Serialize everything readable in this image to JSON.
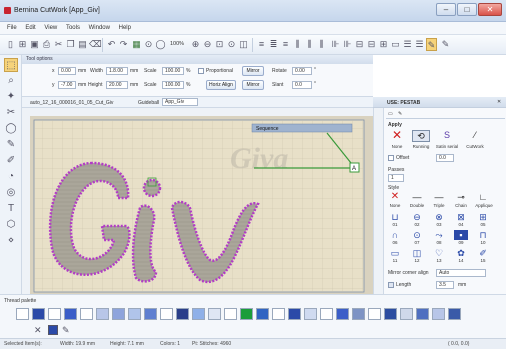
{
  "window": {
    "title": "Bernina CutWork  [App_Giv]",
    "min": "–",
    "max": "□",
    "close": "✕"
  },
  "menu": [
    "File",
    "Edit",
    "View",
    "Tools",
    "Window",
    "Help"
  ],
  "toolbar": {
    "zoom": "100%"
  },
  "props": {
    "header": "Tool options",
    "x_label": "x",
    "x_value": "0.00",
    "y_label": "y",
    "y_value": "-7.00",
    "width_label": "Width",
    "width_value": "1.8.00",
    "height_label": "Height",
    "height_value": "20.00",
    "unit": "mm",
    "scale_label": "Scale",
    "scale_value": "100.00",
    "scaley_label": "Scale",
    "scaley_value": "100.00",
    "percent": "%",
    "proportional_label": "Proportional",
    "mirror_h": "Mirror",
    "mirror_v": "Mirror",
    "rotate_label": "Rotate",
    "rotate_value": "0.00",
    "slant_label": "Slant",
    "slant_value": "0.0",
    "angle_unit": "°",
    "halign": "Horiz Align",
    "valign": "Vert Align"
  },
  "layerbar": {
    "name": "auto_12_16_000016_01_05_Cut_Giv",
    "combo_label": "Guideball",
    "combo_value": "App_Giv"
  },
  "canvas": {
    "ghost_text": "Giva",
    "seq_label": "Sequence",
    "anchor_a": "A"
  },
  "use_panel": {
    "header": "USE: PESTAB",
    "section": "Apply",
    "line_types": [
      "None",
      "Running",
      "Satin serial",
      "CutWork"
    ],
    "offset_label": "Offset",
    "offset_value": "0.0",
    "passes_label": "Passes",
    "passes_value": "1",
    "style_label": "Style",
    "styles": [
      "None",
      "Double",
      "Triple",
      "Chain",
      "Applique"
    ],
    "grid_row1": [
      "01",
      "02",
      "03",
      "04",
      "05"
    ],
    "grid_row2": [
      "06",
      "07",
      "08",
      "09",
      "10"
    ],
    "grid_row3": [
      "11",
      "12",
      "13",
      "14",
      "15"
    ],
    "mirror_label": "Mirror corner align",
    "mirror_value": "Auto",
    "length_label": "Length",
    "length_value": "3.5",
    "length_unit": "mm"
  },
  "thread_palette": {
    "header": "Thread palette",
    "colors": [
      "#ffffff",
      "#2b4aa8",
      "#ffffff",
      "#3b5ec8",
      "#ffffff",
      "#b8c6e8",
      "#8ea4dc",
      "#b0c4ea",
      "#5e7fd0",
      "#ffffff",
      "#2a3f8a",
      "#8fb0e8",
      "#dfe6f4",
      "#ffffff",
      "#1b9d3a",
      "#2f64c2",
      "#ffffff",
      "#2b4aa8",
      "#cfdaf0",
      "#ffffff",
      "#3b5ec8",
      "#7d93c4",
      "#ffffff",
      "#2c4da0",
      "#cfd8ea",
      "#4f6fc0",
      "#b8c6e8",
      "#3a5aa8",
      "#e7ecf6"
    ]
  },
  "status": {
    "left": "Selected Item(s):",
    "width": "Width: 19.9 mm",
    "height": "Height: 7.1 mm",
    "colors": "Colors: 1",
    "stitches": "Pt:   Stitches: 4960",
    "coords": "(  0.0,  0.0)"
  },
  "colors": {
    "accent": "#2b4aa8",
    "stitch": "#b23cc6",
    "selection": "#3a9a3a"
  }
}
